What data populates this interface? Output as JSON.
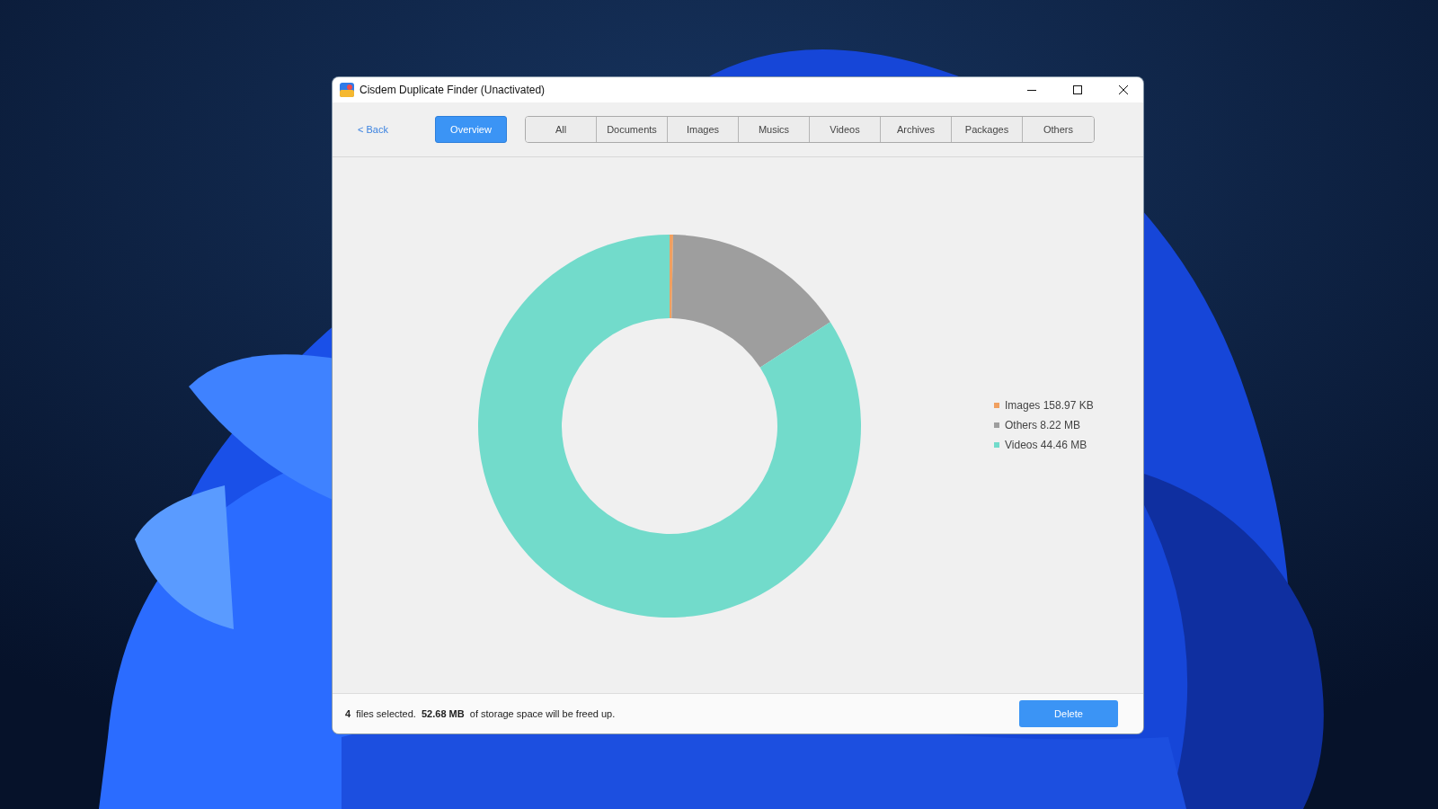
{
  "window": {
    "title": "Cisdem Duplicate Finder (Unactivated)"
  },
  "toolbar": {
    "back": "< Back",
    "overview": {
      "label": "Overview",
      "selected": true
    },
    "tabs": [
      {
        "label": "All",
        "selected": false
      },
      {
        "label": "Documents",
        "selected": false
      },
      {
        "label": "Images",
        "selected": false
      },
      {
        "label": "Musics",
        "selected": false
      },
      {
        "label": "Videos",
        "selected": false
      },
      {
        "label": "Archives",
        "selected": false
      },
      {
        "label": "Packages",
        "selected": false
      },
      {
        "label": "Others",
        "selected": false
      }
    ]
  },
  "overview": {
    "legend": [
      {
        "label": "Images 158.97 KB",
        "color": "#f0a060"
      },
      {
        "label": "Others 8.22 MB",
        "color": "#9e9e9e"
      },
      {
        "label": "Videos 44.46 MB",
        "color": "#72dbcb"
      }
    ],
    "chart_data": {
      "type": "donut",
      "values": [
        0.3,
        15.56,
        84.14
      ]
    }
  },
  "status_bar": {
    "summary": "**4**  files selected.  **52.68 MB**  of storage space will be freed up.",
    "delete": "Delete"
  }
}
